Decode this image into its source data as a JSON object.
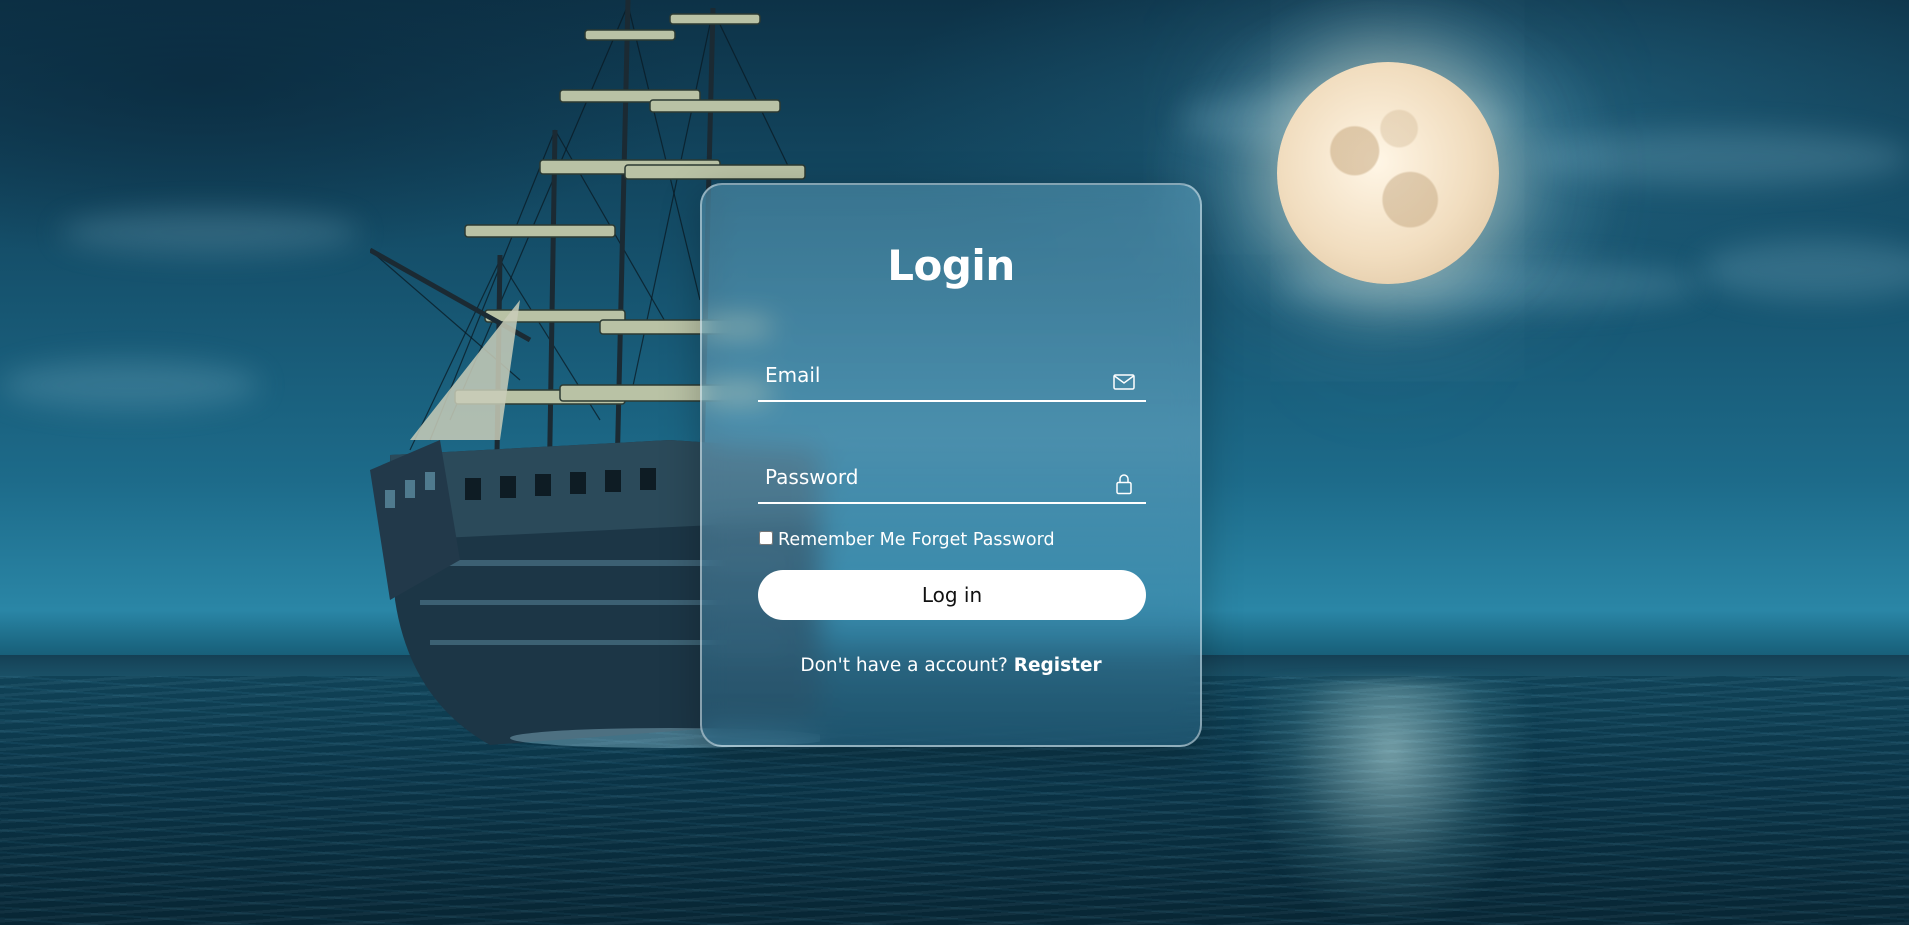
{
  "background": {
    "scene": "night-sea-with-ship-and-full-moon",
    "colors": {
      "sky": "#15506b",
      "sea": "#0c3a4f",
      "moon": "#f1ddbf"
    }
  },
  "login_form": {
    "title": "Login",
    "email": {
      "placeholder": "Email",
      "value": "",
      "icon": "mail-icon"
    },
    "password": {
      "placeholder": "Password",
      "value": "",
      "icon": "lock-icon"
    },
    "remember_label": "Remember Me",
    "remember_checked": false,
    "forgot_label": "Forget Password",
    "submit_label": "Log in",
    "register_prompt": "Don't have a account?",
    "register_link": "Register",
    "colors": {
      "button_bg": "#ffffff",
      "button_text": "#111111",
      "text": "#ffffff"
    }
  }
}
